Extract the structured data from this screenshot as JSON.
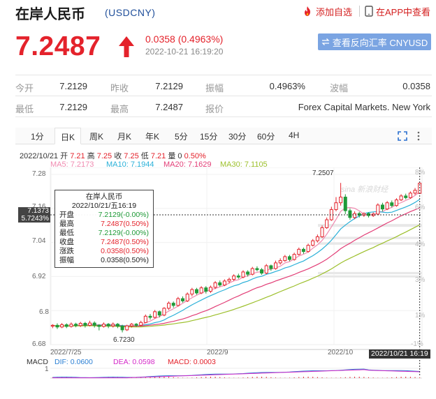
{
  "header": {
    "title": "在岸人民币",
    "code": "(USDCNY)",
    "add_watchlist": "添加自选",
    "open_in_app": "在APP中查看"
  },
  "quote": {
    "price": "7.2487",
    "change": "0.0358 (0.4963%)",
    "time": "2022-10-21 16:19:20",
    "reverse_btn": "查看反向汇率 CNYUSD",
    "direction": "up",
    "up_color": "#e4222b"
  },
  "stats": {
    "row1": [
      {
        "label": "今开",
        "value": "7.2129"
      },
      {
        "label": "昨收",
        "value": "7.2129"
      },
      {
        "label": "振幅",
        "value": "0.4963%"
      },
      {
        "label": "波幅",
        "value": "0.0358"
      }
    ],
    "row2": [
      {
        "label": "最低",
        "value": "7.2129"
      },
      {
        "label": "最高",
        "value": "7.2487"
      },
      {
        "label": "报价",
        "value": "Forex Capital Markets. New York"
      }
    ]
  },
  "tabs": [
    "1分",
    "日K",
    "周K",
    "月K",
    "年K",
    "5分",
    "15分",
    "30分",
    "60分",
    "4H"
  ],
  "active_tab": "日K",
  "ohlc_line": {
    "date": "2022/10/21",
    "open_lbl": "开",
    "open": "7.21",
    "high_lbl": "高",
    "high": "7.25",
    "close_lbl": "收",
    "close": "7.25",
    "low_lbl": "低",
    "low": "7.21",
    "vol_lbl": "量",
    "vol": "0",
    "pct": "0.50%"
  },
  "ma": [
    {
      "label": "MA5: 7.2173",
      "color": "#f08ab0"
    },
    {
      "label": "MA10: 7.1944",
      "color": "#2ab0d8"
    },
    {
      "label": "MA20: 7.1629",
      "color": "#e23d76"
    },
    {
      "label": "MA30: 7.1105",
      "color": "#9cbf2a"
    }
  ],
  "tooltip": {
    "title": "在岸人民币",
    "date": "2022/10/21/五16:19",
    "rows": [
      {
        "k": "开盘",
        "v": "7.2129(-0.00%)",
        "c": "#1f9a38"
      },
      {
        "k": "最高",
        "v": "7.2487(0.50%)",
        "c": "#e4222b"
      },
      {
        "k": "最低",
        "v": "7.2129(-0.00%)",
        "c": "#1f9a38"
      },
      {
        "k": "收盘",
        "v": "7.2487(0.50%)",
        "c": "#e4222b"
      },
      {
        "k": "涨跌",
        "v": "0.0358(0.50%)",
        "c": "#e4222b"
      },
      {
        "k": "振幅",
        "v": "0.0358(0.50%)",
        "c": "#222"
      }
    ]
  },
  "crosshair": {
    "price": "7.1373",
    "pct": "5.7243%"
  },
  "chart_data": {
    "type": "candlestick",
    "y_ticks": [
      "7.28",
      "7.16",
      "7.04",
      "6.92",
      "6.8",
      "6.68"
    ],
    "pct_ticks": [
      "8%",
      "6%",
      "4%",
      "3%",
      "1%",
      "-1%"
    ],
    "x_ticks": [
      "2022/7/25",
      "2022/9",
      "2022/10"
    ],
    "ylim": [
      6.68,
      7.28
    ],
    "max_label": "7.2507",
    "min_label": "6.7230",
    "cursor_date": "2022/10/21 16:19",
    "watermark": "sina 新浪财经",
    "candles": [
      [
        6.745,
        6.748,
        6.738,
        6.752
      ],
      [
        6.748,
        6.742,
        6.735,
        6.755
      ],
      [
        6.742,
        6.75,
        6.738,
        6.756
      ],
      [
        6.75,
        6.744,
        6.738,
        6.755
      ],
      [
        6.744,
        6.752,
        6.74,
        6.758
      ],
      [
        6.752,
        6.747,
        6.741,
        6.757
      ],
      [
        6.747,
        6.755,
        6.742,
        6.76
      ],
      [
        6.755,
        6.748,
        6.74,
        6.76
      ],
      [
        6.748,
        6.756,
        6.744,
        6.764
      ],
      [
        6.756,
        6.748,
        6.74,
        6.762
      ],
      [
        6.748,
        6.744,
        6.73,
        6.752
      ],
      [
        6.744,
        6.752,
        6.74,
        6.758
      ],
      [
        6.752,
        6.746,
        6.738,
        6.756
      ],
      [
        6.746,
        6.752,
        6.74,
        6.758
      ],
      [
        6.752,
        6.745,
        6.738,
        6.756
      ],
      [
        6.745,
        6.732,
        6.723,
        6.75
      ],
      [
        6.732,
        6.746,
        6.728,
        6.75
      ],
      [
        6.746,
        6.752,
        6.74,
        6.756
      ],
      [
        6.752,
        6.748,
        6.742,
        6.756
      ],
      [
        6.748,
        6.758,
        6.744,
        6.764
      ],
      [
        6.758,
        6.78,
        6.756,
        6.786
      ],
      [
        6.78,
        6.776,
        6.768,
        6.788
      ],
      [
        6.776,
        6.796,
        6.772,
        6.802
      ],
      [
        6.796,
        6.784,
        6.776,
        6.8
      ],
      [
        6.784,
        6.808,
        6.78,
        6.812
      ],
      [
        6.808,
        6.826,
        6.802,
        6.832
      ],
      [
        6.826,
        6.818,
        6.81,
        6.832
      ],
      [
        6.818,
        6.842,
        6.814,
        6.848
      ],
      [
        6.842,
        6.834,
        6.828,
        6.85
      ],
      [
        6.834,
        6.858,
        6.83,
        6.864
      ],
      [
        6.858,
        6.874,
        6.85,
        6.88
      ],
      [
        6.874,
        6.862,
        6.856,
        6.88
      ],
      [
        6.862,
        6.88,
        6.858,
        6.886
      ],
      [
        6.88,
        6.868,
        6.86,
        6.886
      ],
      [
        6.868,
        6.882,
        6.862,
        6.888
      ],
      [
        6.882,
        6.898,
        6.876,
        6.904
      ],
      [
        6.898,
        6.89,
        6.884,
        6.906
      ],
      [
        6.89,
        6.904,
        6.886,
        6.91
      ],
      [
        6.904,
        6.91,
        6.896,
        6.916
      ],
      [
        6.91,
        6.922,
        6.904,
        6.928
      ],
      [
        6.922,
        6.918,
        6.912,
        6.93
      ],
      [
        6.918,
        6.936,
        6.914,
        6.942
      ],
      [
        6.936,
        6.928,
        6.92,
        6.942
      ],
      [
        6.928,
        6.948,
        6.924,
        6.954
      ],
      [
        6.948,
        6.944,
        6.938,
        6.956
      ],
      [
        6.944,
        6.932,
        6.926,
        6.95
      ],
      [
        6.932,
        6.958,
        6.928,
        6.964
      ],
      [
        6.958,
        6.948,
        6.94,
        6.962
      ],
      [
        6.948,
        6.968,
        6.944,
        6.976
      ],
      [
        6.968,
        6.976,
        6.962,
        6.984
      ],
      [
        6.976,
        6.99,
        6.972,
        6.996
      ],
      [
        6.99,
        6.98,
        6.974,
        6.996
      ],
      [
        6.98,
        6.998,
        6.976,
        7.004
      ],
      [
        6.998,
        7.016,
        6.994,
        7.022
      ],
      [
        7.016,
        7.008,
        7.0,
        7.022
      ],
      [
        7.008,
        7.03,
        7.004,
        7.036
      ],
      [
        7.03,
        7.046,
        7.026,
        7.052
      ],
      [
        7.046,
        7.06,
        7.04,
        7.068
      ],
      [
        7.06,
        7.092,
        7.056,
        7.1
      ],
      [
        7.092,
        7.12,
        7.088,
        7.128
      ],
      [
        7.12,
        7.156,
        7.116,
        7.166
      ],
      [
        7.156,
        7.18,
        7.15,
        7.2
      ],
      [
        7.18,
        7.2,
        7.17,
        7.25
      ],
      [
        7.2,
        7.152,
        7.14,
        7.21
      ],
      [
        7.152,
        7.128,
        7.12,
        7.16
      ],
      [
        7.128,
        7.142,
        7.122,
        7.15
      ],
      [
        7.142,
        7.136,
        7.128,
        7.148
      ],
      [
        7.136,
        7.142,
        7.13,
        7.146
      ],
      [
        7.142,
        7.135,
        7.128,
        7.146
      ],
      [
        7.135,
        7.14,
        7.13,
        7.146
      ],
      [
        7.14,
        7.172,
        7.136,
        7.178
      ],
      [
        7.172,
        7.158,
        7.15,
        7.18
      ],
      [
        7.158,
        7.18,
        7.154,
        7.186
      ],
      [
        7.18,
        7.17,
        7.164,
        7.188
      ],
      [
        7.17,
        7.19,
        7.166,
        7.196
      ],
      [
        7.19,
        7.204,
        7.186,
        7.21
      ],
      [
        7.204,
        7.198,
        7.192,
        7.212
      ],
      [
        7.198,
        7.214,
        7.194,
        7.22
      ],
      [
        7.214,
        7.224,
        7.208,
        7.232
      ],
      [
        7.213,
        7.249,
        7.213,
        7.251
      ]
    ]
  },
  "macd": {
    "label": "MACD",
    "dif": "DIF: 0.0600",
    "dea": "DEA: 0.0598",
    "macd": "MACD: 0.0003",
    "dif_color": "#2a7fd4",
    "dea_color": "#d428c8",
    "macd_color": "#e4222b",
    "y_tick": "1"
  }
}
